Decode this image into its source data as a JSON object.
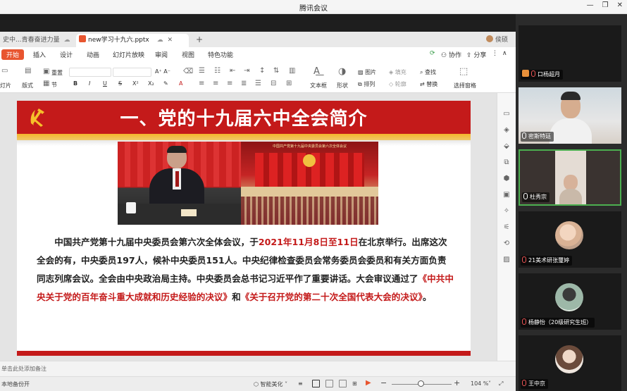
{
  "window": {
    "title": "腾讯会议",
    "controls": [
      "—",
      "❐",
      "✕"
    ]
  },
  "tabs": [
    {
      "label": "史中...青春奋进力量",
      "active": false
    },
    {
      "label": "new学习十九六.pptx",
      "active": true
    }
  ],
  "user": {
    "name": "侯硕"
  },
  "menu": {
    "items": [
      "开始",
      "插入",
      "设计",
      "动画",
      "幻灯片放映",
      "审阅",
      "视图",
      "特色功能"
    ],
    "right": [
      "协作",
      "分享"
    ]
  },
  "ribbon": {
    "left_labels": [
      "灯片",
      "版式",
      "重置",
      "节"
    ],
    "text_labels": [
      "文本框",
      "形状",
      "图片",
      "排列",
      "填充",
      "轮廓",
      "查找",
      "替换",
      "选择窗格"
    ]
  },
  "slide": {
    "title": "一、党的十九届六中全会简介",
    "photo2_caption": "中国共产党第十九届中央委员会第六次全体会议",
    "body": [
      {
        "text": "中国共产党第十九届中央委员会第六次全体会议，于",
        "red": false
      },
      {
        "text": "2021年11月8日至11日",
        "red": true
      },
      {
        "text": "在北京举行。出席这次全会的有，中央委员197人，候补中央委员151人。中央纪律检查委员会常务委员会委员和有关方面负责同志列席会议。全会由中央政治局主持。中央委员会总书记习近平作了重要讲话。大会审议通过了",
        "red": false
      },
      {
        "text": "《中共中央关于党的百年奋斗重大成就和历史经验的决议》",
        "red": true
      },
      {
        "text": "和",
        "red": false
      },
      {
        "text": "《关于召开党的第二十次全国代表大会的决议》",
        "red": true
      },
      {
        "text": "。",
        "red": false
      }
    ]
  },
  "notes": {
    "placeholder": "单击此处添加备注"
  },
  "status": {
    "backup": "本地备份开",
    "beautify": "智能美化",
    "zoom": "104 %",
    "zoom_fraction": 0.5
  },
  "participants": [
    {
      "name": "口杨超月",
      "video": false,
      "mic_muted": true
    },
    {
      "name": "密斯特廷",
      "video": true,
      "mic_muted": false
    },
    {
      "name": "杜秀宗",
      "video": true,
      "mic_muted": false
    },
    {
      "name": "21美术研张璽婷",
      "video": false,
      "mic_muted": true
    },
    {
      "name": "杨静怡（20级研究生班）",
      "video": false,
      "mic_muted": true
    },
    {
      "name": "王中京",
      "video": false,
      "mic_muted": true
    }
  ]
}
